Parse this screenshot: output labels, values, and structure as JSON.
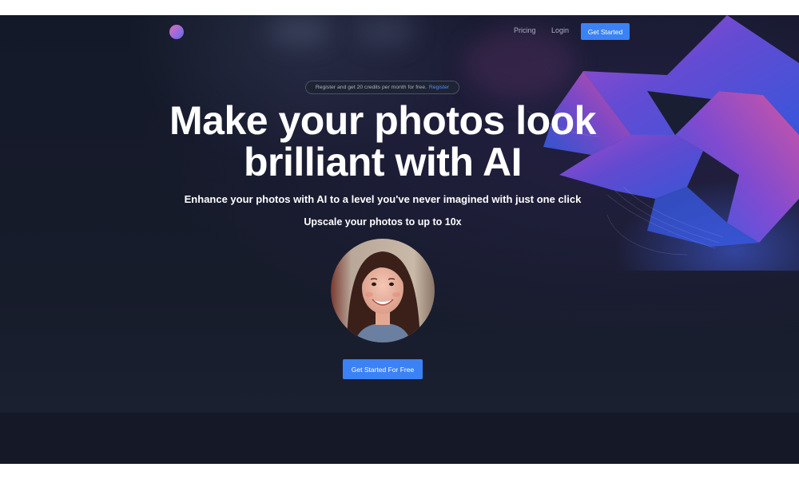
{
  "nav": {
    "pricing_label": "Pricing",
    "login_label": "Login",
    "cta_label": "Get Started"
  },
  "announcement": {
    "text": "Register and get 20 credits per month for free.",
    "link_label": "Register"
  },
  "hero": {
    "headline_line1": "Make your photos look",
    "headline_line2": "brilliant with AI",
    "subheadline": "Enhance your photos with AI to a level you've never imagined with just one click",
    "upscale_text": "Upscale your photos to up to 10x",
    "cta_label": "Get Started For Free"
  },
  "colors": {
    "background": "#161b2a",
    "accent": "#3b82f6",
    "link": "#4f8ef7"
  },
  "icons": {
    "logo": "brand-logo-icon"
  }
}
